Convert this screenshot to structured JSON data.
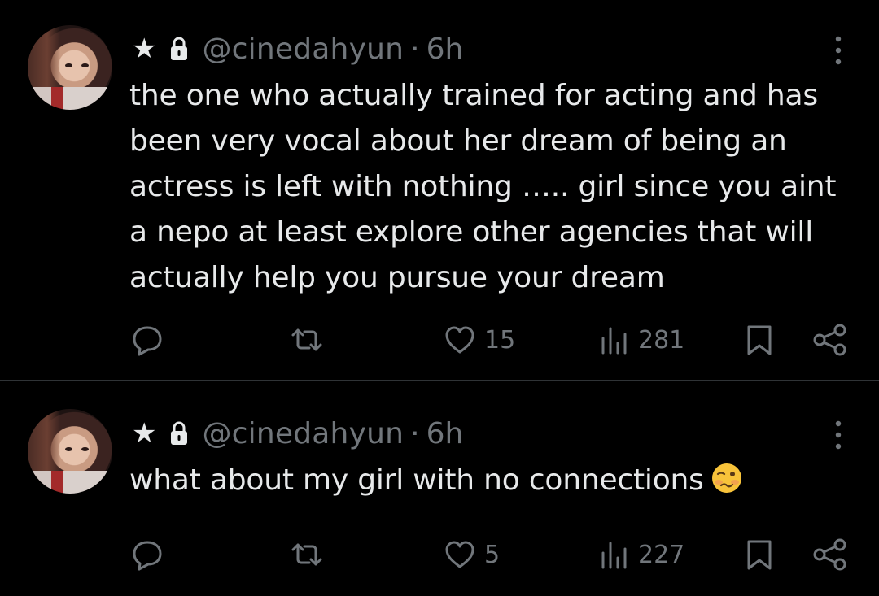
{
  "colors": {
    "background": "#000000",
    "text_primary": "#e7e9ea",
    "text_secondary": "#71767b",
    "divider": "#2f3336"
  },
  "tweets": [
    {
      "star": "★",
      "handle": "@cinedahyun",
      "separator": "·",
      "time": "6h",
      "text": "the one who actually trained for acting and has been very vocal about her dream of being an actress is left with nothing ….. girl since you aint a nepo at least explore other agencies that will actually help you pursue your dream",
      "likes": "15",
      "views": "281",
      "icons": [
        "lock-icon",
        "more-icon",
        "reply-icon",
        "retweet-icon",
        "heart-icon",
        "views-icon",
        "bookmark-icon",
        "share-icon"
      ]
    },
    {
      "star": "★",
      "handle": "@cinedahyun",
      "separator": "·",
      "time": "6h",
      "text": "what about my girl with no connections",
      "emoji": "woozy-face-emoji",
      "likes": "5",
      "views": "227",
      "icons": [
        "lock-icon",
        "more-icon",
        "reply-icon",
        "retweet-icon",
        "heart-icon",
        "views-icon",
        "bookmark-icon",
        "share-icon"
      ]
    }
  ]
}
